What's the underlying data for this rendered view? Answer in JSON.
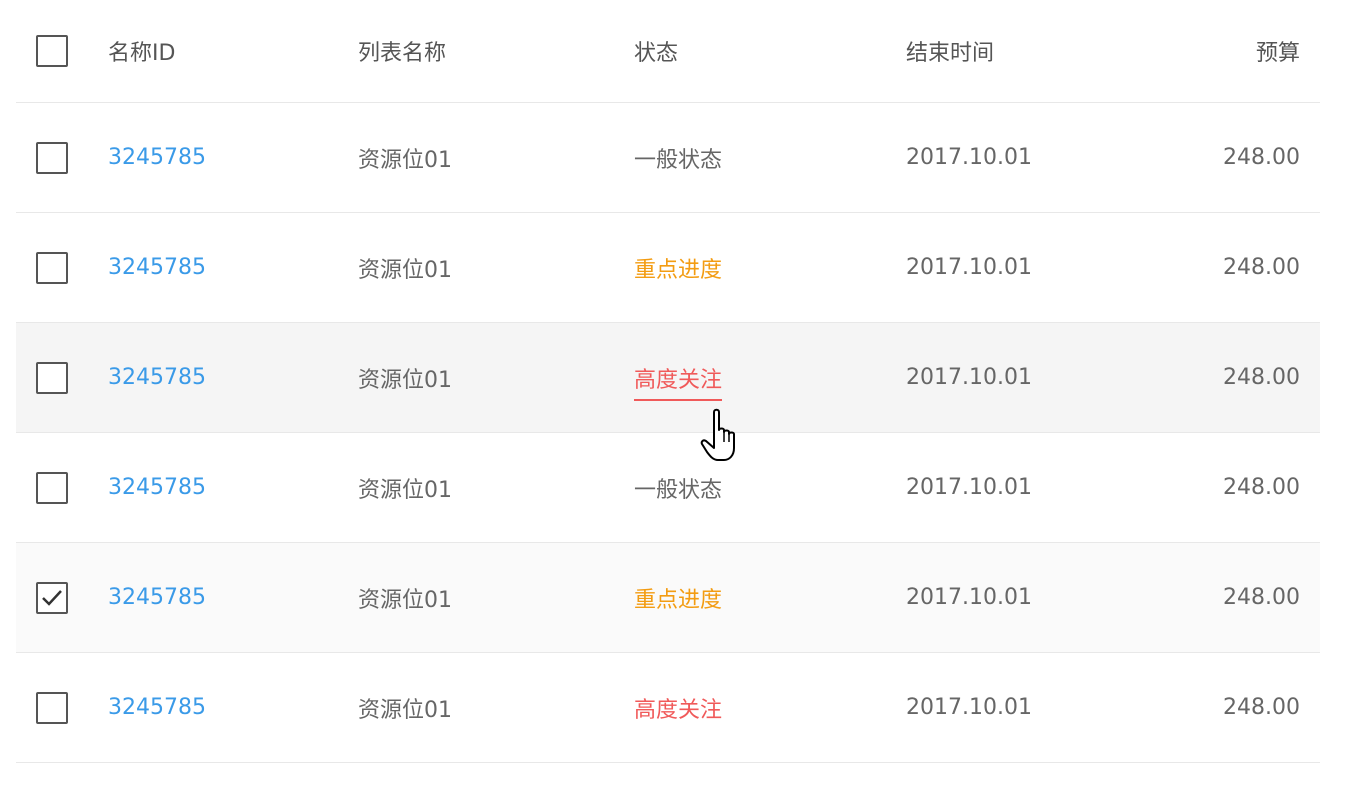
{
  "columns": {
    "select_all": "",
    "id": "名称ID",
    "list_name": "列表名称",
    "status": "状态",
    "end_time": "结束时间",
    "budget": "预算"
  },
  "rows": [
    {
      "checked": false,
      "id": "3245785",
      "list_name": "资源位01",
      "status": "一般状态",
      "status_color": "#666666",
      "end_time": "2017.10.01",
      "budget": "248.00"
    },
    {
      "checked": false,
      "id": "3245785",
      "list_name": "资源位01",
      "status": "重点进度",
      "status_color": "#f39c12",
      "end_time": "2017.10.01",
      "budget": "248.00"
    },
    {
      "checked": false,
      "id": "3245785",
      "list_name": "资源位01",
      "status": "高度关注",
      "status_color": "#f05a5a",
      "end_time": "2017.10.01",
      "budget": "248.00"
    },
    {
      "checked": false,
      "id": "3245785",
      "list_name": "资源位01",
      "status": "一般状态",
      "status_color": "#666666",
      "end_time": "2017.10.01",
      "budget": "248.00"
    },
    {
      "checked": true,
      "id": "3245785",
      "list_name": "资源位01",
      "status": "重点进度",
      "status_color": "#f39c12",
      "end_time": "2017.10.01",
      "budget": "248.00"
    },
    {
      "checked": false,
      "id": "3245785",
      "list_name": "资源位01",
      "status": "高度关注",
      "status_color": "#f05a5a",
      "end_time": "2017.10.01",
      "budget": "248.00"
    }
  ],
  "colors": {
    "link": "#3a9ae8",
    "text": "#666666",
    "border": "#e8e8e8",
    "hover_bg": "#f5f5f5"
  },
  "cursor_icon": "hand-pointer-icon"
}
